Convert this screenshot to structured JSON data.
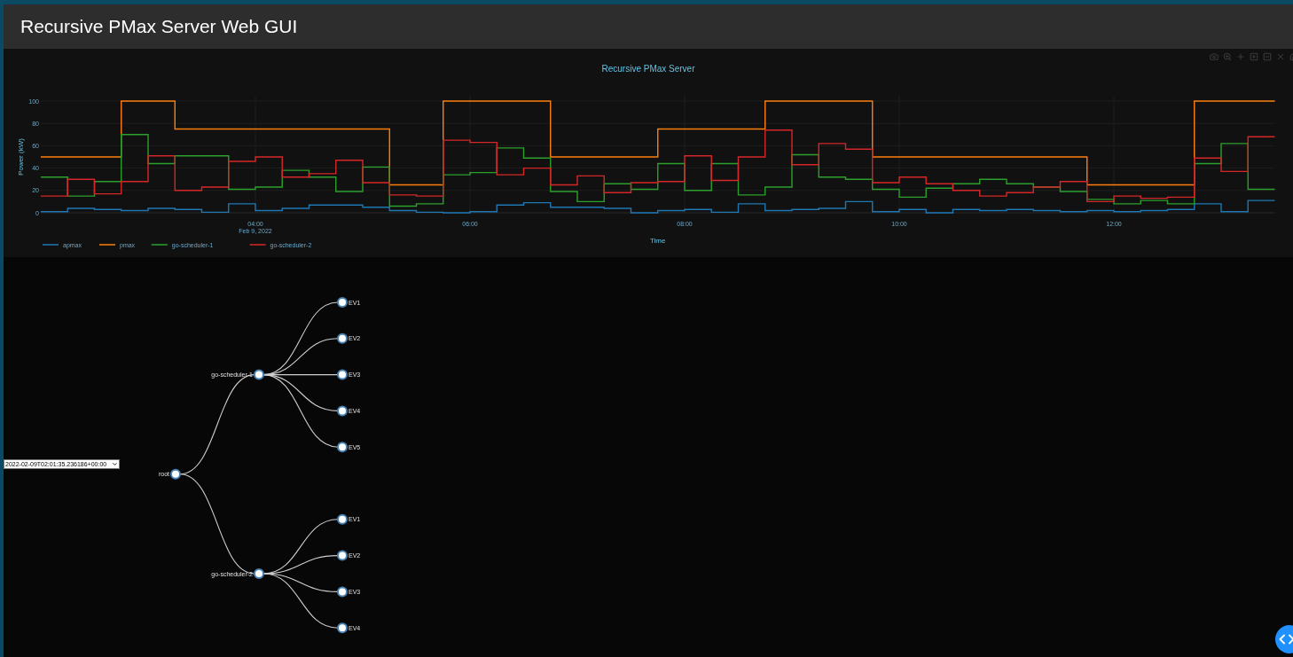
{
  "header": {
    "title": "Recursive PMax Server Web GUI"
  },
  "chart": {
    "date_label": "Feb 9, 2022",
    "chart_data": {
      "type": "line",
      "title": "Recursive PMax Server",
      "xlabel": "Time",
      "ylabel": "Power (kW)",
      "x": [
        2,
        2.25,
        2.25,
        2.5,
        2.5,
        2.75,
        2.75,
        3,
        3,
        3.25,
        3.25,
        3.5,
        3.5,
        3.75,
        3.75,
        4,
        4,
        4.25,
        4.25,
        4.5,
        4.5,
        4.75,
        4.75,
        5,
        5,
        5.25,
        5.25,
        5.5,
        5.5,
        5.75,
        5.75,
        6,
        6,
        6.25,
        6.25,
        6.5,
        6.5,
        6.75,
        6.75,
        7,
        7,
        7.25,
        7.25,
        7.5,
        7.5,
        7.75,
        7.75,
        8,
        8,
        8.25,
        8.25,
        8.5,
        8.5,
        8.75,
        8.75,
        9,
        9,
        9.25,
        9.25,
        9.5,
        9.5,
        9.75,
        9.75,
        10,
        10,
        10.25,
        10.25,
        10.5,
        10.5,
        10.75,
        10.75,
        11,
        11,
        11.25,
        11.25,
        11.5,
        11.5,
        11.75,
        11.75,
        12,
        12,
        12.25,
        12.25,
        12.5,
        12.5,
        12.75,
        12.75,
        13,
        13,
        13.25,
        13.25,
        13.5,
        13.5
      ],
      "series": [
        {
          "name": "apmax",
          "color": "#1f77b4",
          "values": [
            1,
            1,
            4,
            4,
            3,
            3,
            2,
            2,
            4,
            4,
            3,
            3,
            0.5,
            0.5,
            8,
            8,
            2,
            2,
            4,
            4,
            7,
            7,
            7,
            7,
            5,
            5,
            2,
            2,
            0.5,
            0.5,
            0,
            0,
            1,
            1,
            7,
            7,
            9,
            9,
            5,
            5,
            5,
            5,
            4,
            4,
            0,
            0,
            2,
            2,
            3,
            3,
            0.5,
            0.5,
            8,
            8,
            2,
            2,
            3,
            3,
            4,
            4,
            10,
            10,
            1,
            1,
            3,
            3,
            0,
            0,
            3,
            3,
            2,
            2,
            3,
            3,
            2,
            2,
            1,
            1,
            2,
            2,
            1,
            1,
            2,
            2,
            3,
            3,
            8,
            8,
            1,
            1,
            11,
            11,
            11
          ]
        },
        {
          "name": "pmax",
          "color": "#ff7f0e",
          "values": [
            50,
            50,
            50,
            50,
            50,
            50,
            100,
            100,
            100,
            100,
            75,
            75,
            75,
            75,
            75,
            75,
            75,
            75,
            75,
            75,
            75,
            75,
            75,
            75,
            75,
            75,
            25,
            25,
            25,
            25,
            100,
            100,
            100,
            100,
            100,
            100,
            100,
            100,
            50,
            50,
            50,
            50,
            50,
            50,
            50,
            50,
            75,
            75,
            75,
            75,
            75,
            75,
            75,
            75,
            100,
            100,
            100,
            100,
            100,
            100,
            100,
            100,
            50,
            50,
            50,
            50,
            50,
            50,
            50,
            50,
            50,
            50,
            50,
            50,
            50,
            50,
            50,
            50,
            25,
            25,
            25,
            25,
            25,
            25,
            25,
            25,
            100,
            100,
            100,
            100,
            100,
            100,
            100
          ]
        },
        {
          "name": "go-scheduler-1",
          "color": "#2ca02c",
          "values": [
            32,
            32,
            15,
            15,
            28,
            28,
            70,
            70,
            44,
            44,
            51,
            51,
            51,
            51,
            21,
            21,
            23,
            23,
            38,
            38,
            32,
            32,
            19,
            19,
            41,
            41,
            6,
            6,
            8,
            8,
            34,
            34,
            36,
            36,
            58,
            58,
            49,
            49,
            19,
            19,
            10,
            10,
            26,
            26,
            21,
            21,
            44,
            44,
            20,
            20,
            44,
            44,
            16,
            16,
            23,
            23,
            52,
            52,
            32,
            32,
            30,
            30,
            21,
            21,
            14,
            14,
            22,
            22,
            26,
            26,
            30,
            30,
            26,
            26,
            23,
            23,
            19,
            19,
            12,
            12,
            8,
            8,
            11,
            11,
            8,
            8,
            44,
            44,
            62,
            62,
            21,
            21,
            21
          ]
        },
        {
          "name": "go-scheduler-2",
          "color": "#d62728",
          "values": [
            15,
            15,
            30,
            30,
            17,
            17,
            28,
            28,
            51,
            51,
            20,
            20,
            23,
            23,
            46,
            46,
            50,
            50,
            32,
            32,
            35,
            35,
            47,
            47,
            27,
            27,
            16,
            16,
            15,
            15,
            65,
            65,
            63,
            63,
            34,
            34,
            40,
            40,
            25,
            25,
            33,
            33,
            18,
            18,
            27,
            27,
            28,
            28,
            51,
            51,
            29,
            29,
            50,
            50,
            74,
            74,
            43,
            43,
            62,
            62,
            57,
            57,
            27,
            27,
            32,
            32,
            26,
            26,
            20,
            20,
            15,
            15,
            18,
            18,
            23,
            23,
            28,
            28,
            10,
            10,
            15,
            15,
            13,
            13,
            14,
            14,
            49,
            49,
            37,
            37,
            68,
            68,
            68
          ]
        }
      ],
      "grid": true,
      "legend": true,
      "xlim": [
        2,
        13.5
      ],
      "ylim": [
        0,
        100
      ],
      "xticks": [
        {
          "value": 4,
          "label": "04:00"
        },
        {
          "value": 6,
          "label": "06:00"
        },
        {
          "value": 8,
          "label": "08:00"
        },
        {
          "value": 10,
          "label": "10:00"
        },
        {
          "value": 12,
          "label": "12:00"
        }
      ],
      "yticks": [
        0,
        20,
        40,
        60,
        80,
        100
      ]
    }
  },
  "timestamp_select": {
    "value": "2022-02-09T02:01:35.236186+00:00"
  },
  "tree": {
    "name": "root",
    "children": [
      {
        "name": "go-scheduler-1",
        "children": [
          {
            "name": "EV1"
          },
          {
            "name": "EV2"
          },
          {
            "name": "EV3"
          },
          {
            "name": "EV4"
          },
          {
            "name": "EV5"
          }
        ]
      },
      {
        "name": "go-scheduler-2",
        "children": [
          {
            "name": "EV1"
          },
          {
            "name": "EV2"
          },
          {
            "name": "EV3"
          },
          {
            "name": "EV4"
          }
        ]
      }
    ]
  }
}
